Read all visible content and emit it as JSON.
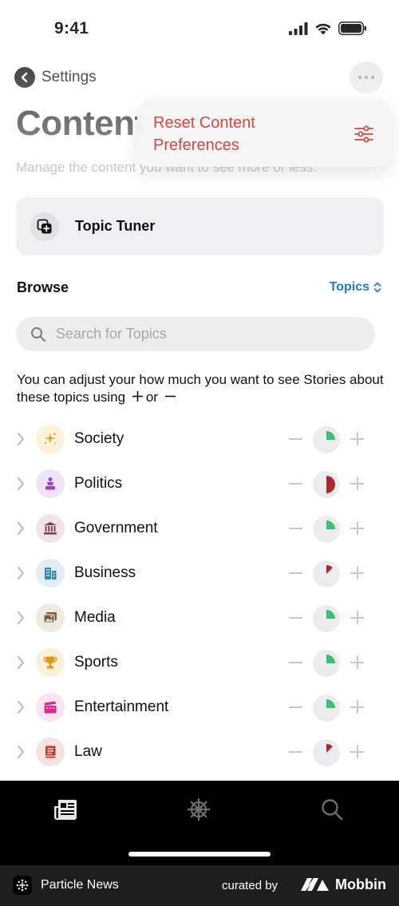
{
  "status_bar": {
    "time": "9:41"
  },
  "nav": {
    "back_label": "Settings"
  },
  "page": {
    "title": "Content",
    "subtitle": "Manage the content you want to see more or less."
  },
  "menu": {
    "reset_label": "Reset Content Preferences"
  },
  "topic_tuner": {
    "label": "Topic Tuner"
  },
  "browse": {
    "title": "Browse",
    "sort_label": "Topics"
  },
  "search": {
    "placeholder": "Search for Topics",
    "value": ""
  },
  "info": {
    "text_before": "You can adjust your how much you want to see Stories about these topics using",
    "text_mid": "or"
  },
  "topics": [
    {
      "label": "Society",
      "icon": "sparkle-icon",
      "icon_bg": "#fdf1d9",
      "icon_color": "#e0a020",
      "level": 0.25,
      "level_color": "#38c172"
    },
    {
      "label": "Politics",
      "icon": "podium-icon",
      "icon_bg": "#efe4f7",
      "icon_color": "#9b45c9",
      "level": 0.5,
      "level_color": "#b3262b"
    },
    {
      "label": "Government",
      "icon": "building-columns-icon",
      "icon_bg": "#f1e4e6",
      "icon_color": "#8a3b4a",
      "level": 0.25,
      "level_color": "#38c172"
    },
    {
      "label": "Business",
      "icon": "office-building-icon",
      "icon_bg": "#e1eef6",
      "icon_color": "#2f88b8",
      "level": 0.125,
      "level_color": "#b3262b"
    },
    {
      "label": "Media",
      "icon": "photos-icon",
      "icon_bg": "#efe9e3",
      "icon_color": "#7a5a3c",
      "level": 0.25,
      "level_color": "#38c172"
    },
    {
      "label": "Sports",
      "icon": "trophy-icon",
      "icon_bg": "#fdf0d9",
      "icon_color": "#e59310",
      "level": 0.25,
      "level_color": "#38c172"
    },
    {
      "label": "Entertainment",
      "icon": "clapperboard-icon",
      "icon_bg": "#fbe3f1",
      "icon_color": "#d62e8f",
      "level": 0.25,
      "level_color": "#38c172"
    },
    {
      "label": "Law",
      "icon": "law-book-icon",
      "icon_bg": "#f7e2e2",
      "icon_color": "#c0392b",
      "level": 0.125,
      "level_color": "#b3262b"
    }
  ],
  "footer": {
    "app_name": "Particle News",
    "curated_by": "curated by",
    "brand": "Mobbin"
  },
  "colors": {
    "accent_red": "#e0433b",
    "accent_blue": "#1e7ad6"
  }
}
